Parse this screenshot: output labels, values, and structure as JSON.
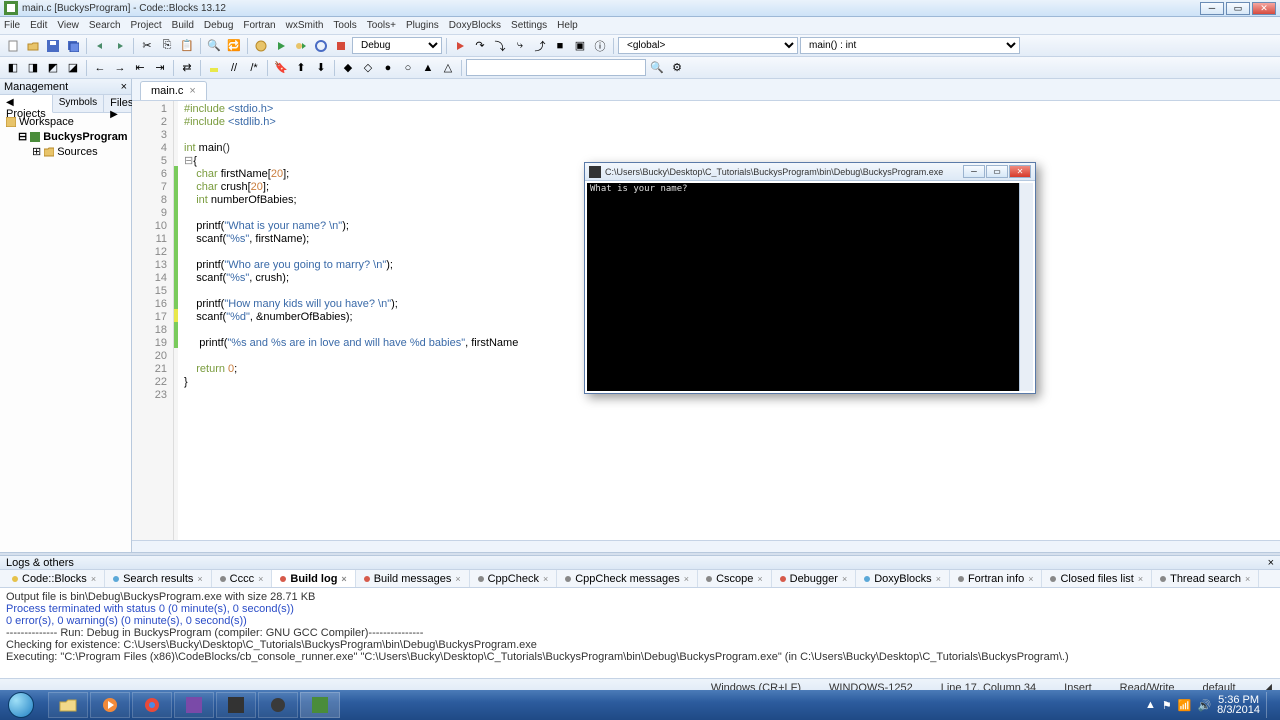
{
  "window": {
    "title": "main.c [BuckysProgram] - Code::Blocks 13.12"
  },
  "menu": [
    "File",
    "Edit",
    "View",
    "Search",
    "Project",
    "Build",
    "Debug",
    "Fortran",
    "wxSmith",
    "Tools",
    "Tools+",
    "Plugins",
    "DoxyBlocks",
    "Settings",
    "Help"
  ],
  "toolbar": {
    "build_target": "Debug",
    "scope": "<global>",
    "func": "main() : int"
  },
  "management": {
    "title": "Management",
    "tabs": [
      "Projects",
      "Symbols",
      "Files"
    ],
    "tree": {
      "workspace": "Workspace",
      "project": "BuckysProgram",
      "folder": "Sources"
    }
  },
  "editor": {
    "tab": "main.c",
    "lines": [
      {
        "n": 1,
        "html": "<span class='pp'>#include</span> <span class='str'>&lt;stdio.h&gt;</span>"
      },
      {
        "n": 2,
        "html": "<span class='pp'>#include</span> <span class='str'>&lt;stdlib.h&gt;</span>"
      },
      {
        "n": 3,
        "html": ""
      },
      {
        "n": 4,
        "html": "<span class='kw'>int</span> main<span class='id'>()</span>"
      },
      {
        "n": 5,
        "html": "<span class='fold'>⊟</span>{"
      },
      {
        "n": 6,
        "html": "    <span class='kw'>char</span> firstName[<span class='num'>20</span>];"
      },
      {
        "n": 7,
        "html": "    <span class='kw'>char</span> crush[<span class='num'>20</span>];"
      },
      {
        "n": 8,
        "html": "    <span class='kw'>int</span> numberOfBabies;"
      },
      {
        "n": 9,
        "html": ""
      },
      {
        "n": 10,
        "html": "    printf(<span class='str'>\"What is your name? \\n\"</span>);"
      },
      {
        "n": 11,
        "html": "    scanf(<span class='str'>\"%s\"</span>, firstName);"
      },
      {
        "n": 12,
        "html": ""
      },
      {
        "n": 13,
        "html": "    printf(<span class='str'>\"Who are you going to marry? \\n\"</span>);"
      },
      {
        "n": 14,
        "html": "    scanf(<span class='str'>\"%s\"</span>, crush);"
      },
      {
        "n": 15,
        "html": ""
      },
      {
        "n": 16,
        "html": "    printf(<span class='str'>\"How many kids will you have? \\n\"</span>);"
      },
      {
        "n": 17,
        "html": "    scanf(<span class='str'>\"%d\"</span>, &amp;numberOfBabies);"
      },
      {
        "n": 18,
        "html": ""
      },
      {
        "n": 19,
        "html": "     printf(<span class='str'>\"%s and %s are in love and will have %d babies\"</span>, firstName"
      },
      {
        "n": 20,
        "html": ""
      },
      {
        "n": 21,
        "html": "    <span class='kw'>return</span> <span class='num'>0</span>;"
      },
      {
        "n": 22,
        "html": "}"
      },
      {
        "n": 23,
        "html": ""
      }
    ],
    "changes": {
      "1": "",
      "2": "",
      "3": "",
      "4": "",
      "5": "",
      "6": "grn",
      "7": "grn",
      "8": "grn",
      "9": "grn",
      "10": "grn",
      "11": "grn",
      "12": "grn",
      "13": "grn",
      "14": "grn",
      "15": "grn",
      "16": "grn",
      "17": "yel",
      "18": "grn",
      "19": "grn",
      "20": "",
      "21": "",
      "22": "",
      "23": ""
    }
  },
  "logs": {
    "title": "Logs & others",
    "tabs": [
      {
        "label": "Code::Blocks",
        "color": "#e6c24a"
      },
      {
        "label": "Search results",
        "color": "#5aa8d8"
      },
      {
        "label": "Cccc",
        "color": "#888"
      },
      {
        "label": "Build log",
        "color": "#d65a4a",
        "active": true
      },
      {
        "label": "Build messages",
        "color": "#d65a4a"
      },
      {
        "label": "CppCheck",
        "color": "#888"
      },
      {
        "label": "CppCheck messages",
        "color": "#888"
      },
      {
        "label": "Cscope",
        "color": "#888"
      },
      {
        "label": "Debugger",
        "color": "#d65a4a"
      },
      {
        "label": "DoxyBlocks",
        "color": "#5aa8d8"
      },
      {
        "label": "Fortran info",
        "color": "#888"
      },
      {
        "label": "Closed files list",
        "color": "#888"
      },
      {
        "label": "Thread search",
        "color": "#888"
      }
    ],
    "body": [
      {
        "t": "Output file is bin\\Debug\\BuckysProgram.exe with size 28.71 KB"
      },
      {
        "t": "Process terminated with status 0 (0 minute(s), 0 second(s))",
        "cls": "blue"
      },
      {
        "t": "0 error(s), 0 warning(s) (0 minute(s), 0 second(s))",
        "cls": "blue"
      },
      {
        "t": " "
      },
      {
        "t": " "
      },
      {
        "t": "-------------- Run: Debug in BuckysProgram (compiler: GNU GCC Compiler)---------------"
      },
      {
        "t": " "
      },
      {
        "t": "Checking for existence: C:\\Users\\Bucky\\Desktop\\C_Tutorials\\BuckysProgram\\bin\\Debug\\BuckysProgram.exe"
      },
      {
        "t": "Executing: \"C:\\Program Files (x86)\\CodeBlocks/cb_console_runner.exe\" \"C:\\Users\\Bucky\\Desktop\\C_Tutorials\\BuckysProgram\\bin\\Debug\\BuckysProgram.exe\"  (in C:\\Users\\Bucky\\Desktop\\C_Tutorials\\BuckysProgram\\.)"
      }
    ]
  },
  "status": {
    "encoding": "Windows (CR+LF)",
    "codepage": "WINDOWS-1252",
    "pos": "Line 17, Column 34",
    "ins": "Insert",
    "rw": "Read/Write",
    "lang": "default"
  },
  "console": {
    "title": "C:\\Users\\Bucky\\Desktop\\C_Tutorials\\BuckysProgram\\bin\\Debug\\BuckysProgram.exe",
    "output": "What is your name?"
  },
  "taskbar": {
    "time": "5:36 PM",
    "date": "8/3/2014"
  }
}
